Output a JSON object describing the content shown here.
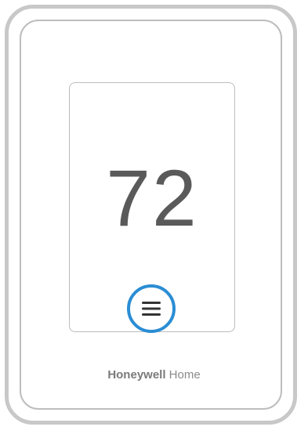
{
  "thermostat": {
    "temperature": "72",
    "menu_icon": "hamburger-menu-icon",
    "accent_color": "#2a8dd4"
  },
  "brand": {
    "name_bold": "Honeywell",
    "name_light": " Home"
  }
}
